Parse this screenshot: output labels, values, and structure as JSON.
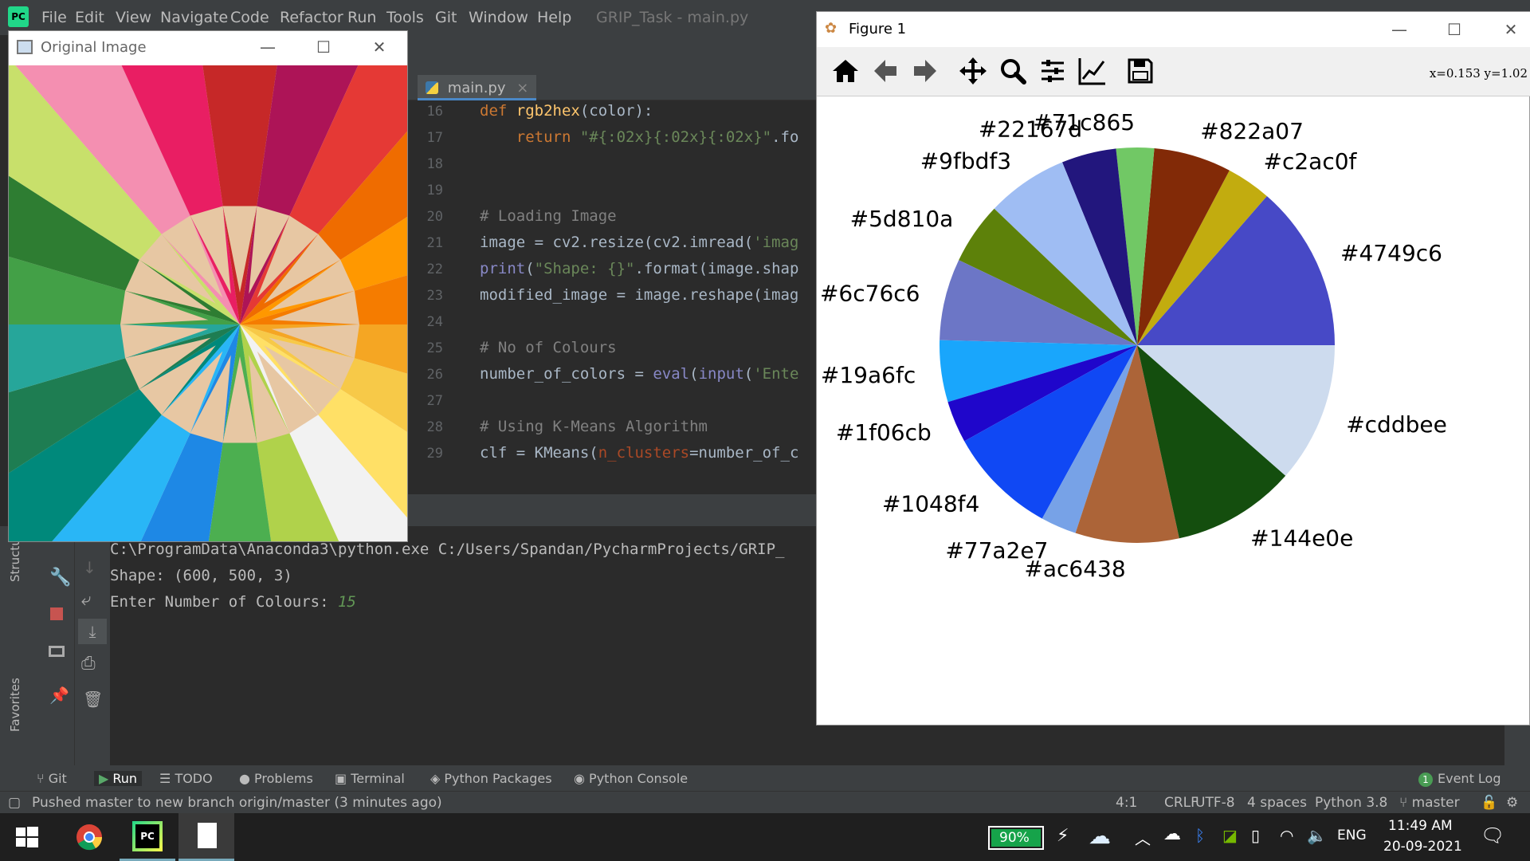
{
  "ide": {
    "menu": [
      "File",
      "Edit",
      "View",
      "Navigate",
      "Code",
      "Refactor",
      "Run",
      "Tools",
      "Git",
      "Window",
      "Help"
    ],
    "title": "GRIP_Task - main.py",
    "logo": "PC"
  },
  "editor": {
    "tab_label": "main.py",
    "line_numbers": [
      "16",
      "17",
      "18",
      "19",
      "20",
      "21",
      "22",
      "23",
      "24",
      "25",
      "26",
      "27",
      "28",
      "29"
    ],
    "lines": [
      [
        {
          "c": "kw",
          "t": "def "
        },
        {
          "c": "fn",
          "t": "rgb2hex"
        },
        {
          "c": "",
          "t": "(color):"
        }
      ],
      [
        {
          "c": "kw",
          "t": "    return "
        },
        {
          "c": "st",
          "t": "\"#{:02x}{:02x}{:02x}\""
        },
        {
          "c": "",
          "t": ".fo"
        }
      ],
      [],
      [],
      [
        {
          "c": "cm",
          "t": "# Loading Image"
        }
      ],
      [
        {
          "c": "",
          "t": "image = cv2.resize(cv2.imread("
        },
        {
          "c": "st",
          "t": "'imag"
        }
      ],
      [
        {
          "c": "bi",
          "t": "print"
        },
        {
          "c": "",
          "t": "("
        },
        {
          "c": "st",
          "t": "\"Shape: {}\""
        },
        {
          "c": "",
          "t": ".format(image.shap"
        }
      ],
      [
        {
          "c": "",
          "t": "modified_image = image.reshape(imag"
        }
      ],
      [],
      [
        {
          "c": "cm",
          "t": "# No of Colours"
        }
      ],
      [
        {
          "c": "",
          "t": "number_of_colors = "
        },
        {
          "c": "bi",
          "t": "eval"
        },
        {
          "c": "",
          "t": "("
        },
        {
          "c": "bi",
          "t": "input"
        },
        {
          "c": "",
          "t": "("
        },
        {
          "c": "st",
          "t": "'Ente"
        }
      ],
      [],
      [
        {
          "c": "cm",
          "t": "# Using K-Means Algorithm"
        }
      ],
      [
        {
          "c": "",
          "t": "clf = KMeans("
        },
        {
          "c": "pr",
          "t": "n_clusters"
        },
        {
          "c": "",
          "t": "=number_of_c"
        }
      ]
    ]
  },
  "console": {
    "line1": "C:\\ProgramData\\Anaconda3\\python.exe C:/Users/Spandan/PycharmProjects/GRIP_",
    "line2": "Shape: (600, 500, 3)",
    "line3_prompt": "Enter Number of Colours: ",
    "line3_input": "15"
  },
  "side_labels": {
    "structure": "Structure",
    "favorites": "Favorites"
  },
  "tool_tabs": [
    "Git",
    "Run",
    "TODO",
    "Problems",
    "Terminal",
    "Python Packages",
    "Python Console"
  ],
  "event_log": "Event Log",
  "event_count": "1",
  "status": {
    "message": "Pushed master to new branch origin/master (3 minutes ago)",
    "position": "4:1",
    "line_sep": "CRLF",
    "encoding": "UTF-8",
    "indent": "4 spaces",
    "interpreter": "Python 3.8",
    "branch": "master"
  },
  "original_window": {
    "title": "Original Image"
  },
  "figure_window": {
    "title": "Figure 1",
    "coords": "x=0.153 y=1.02",
    "toolbar_icons": [
      "home-icon",
      "back-arrow-icon",
      "forward-arrow-icon",
      "pan-icon",
      "zoom-icon",
      "configure-subplots-icon",
      "edit-axis-icon",
      "save-icon"
    ]
  },
  "chart_data": {
    "type": "pie",
    "labels": [
      "#4749c6",
      "#c2ac0f",
      "#822a07",
      "#71c865",
      "#22167d",
      "#9fbdf3",
      "#5d810a",
      "#6c76c6",
      "#19a6fc",
      "#1f06cb",
      "#1048f4",
      "#77a2e7",
      "#ac6438",
      "#144e0e",
      "#cddbee"
    ],
    "colors": [
      "#4749c6",
      "#c2ac0f",
      "#822a07",
      "#71c865",
      "#22167d",
      "#9fbdf3",
      "#5d810a",
      "#6c76c6",
      "#19a6fc",
      "#1f06cb",
      "#1048f4",
      "#77a2e7",
      "#ac6438",
      "#144e0e",
      "#cddbee"
    ],
    "values": [
      16.7,
      4.5,
      7.8,
      3.8,
      5.5,
      8.2,
      6.2,
      8.2,
      6.2,
      4.2,
      11.0,
      3.6,
      10.4,
      12.4,
      14.1
    ]
  },
  "taskbar": {
    "battery": "90%",
    "language": "ENG",
    "time": "11:49 AM",
    "date": "20-09-2021"
  }
}
